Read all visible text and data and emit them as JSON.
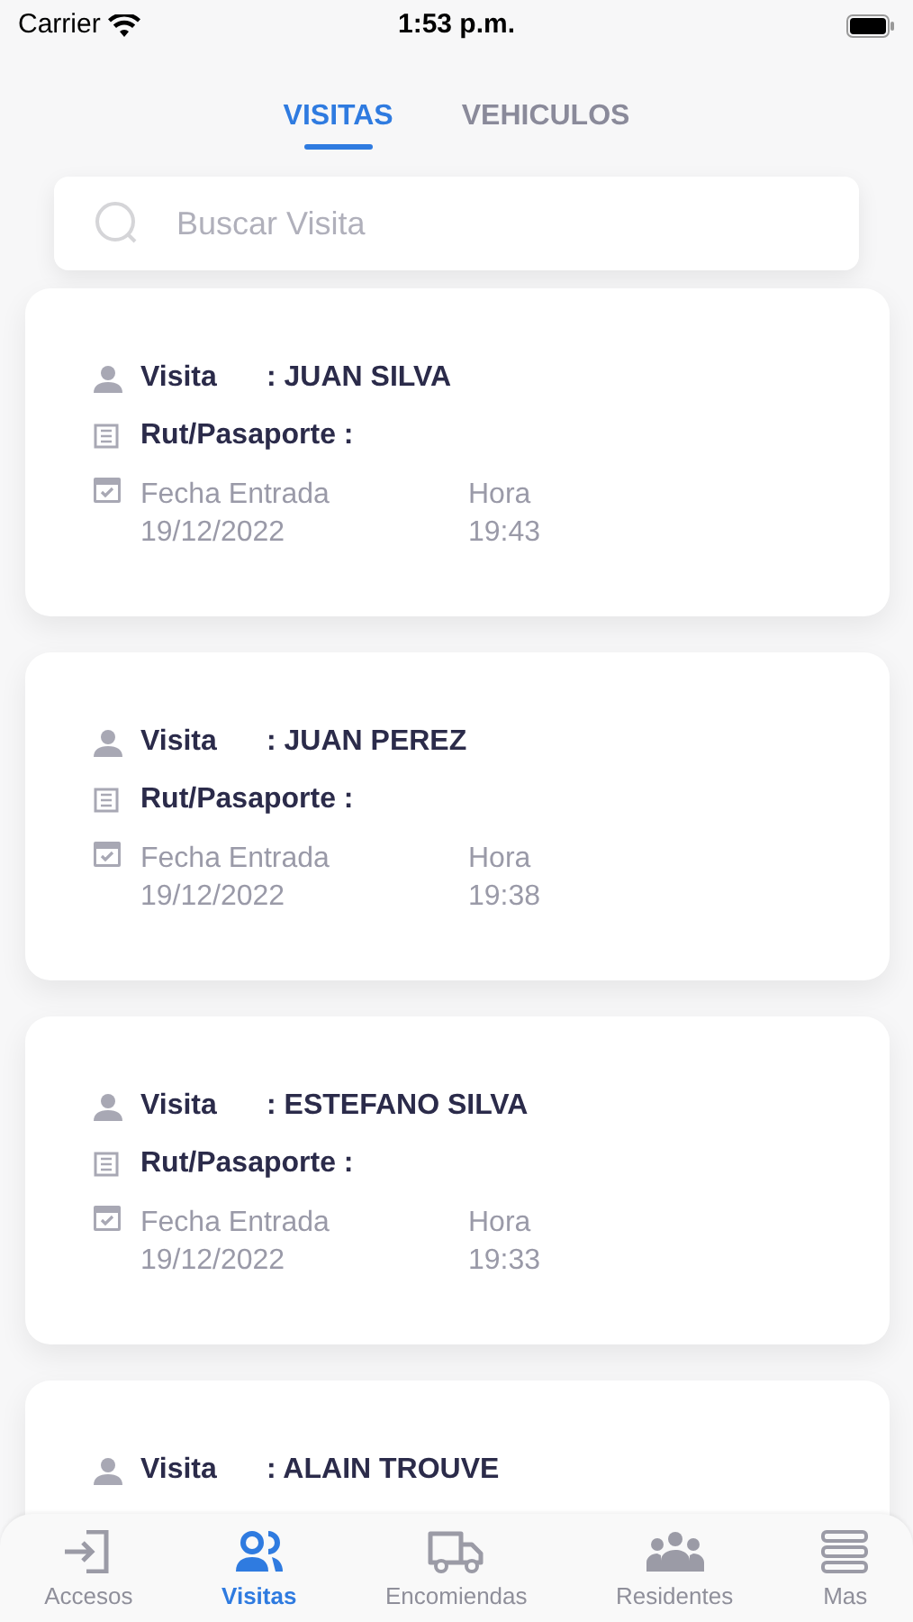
{
  "status_bar": {
    "carrier": "Carrier",
    "time": "1:53 p.m."
  },
  "tabs": [
    {
      "label": "VISITAS",
      "selected": true
    },
    {
      "label": "VEHICULOS",
      "selected": false
    }
  ],
  "search": {
    "placeholder": "Buscar Visita"
  },
  "visits": [
    {
      "visit_label": "Visita",
      "visitor": ": JUAN SILVA",
      "id_label": "Rut/Pasaporte :",
      "date_label": "Fecha Entrada",
      "date": "19/12/2022",
      "time_label": "Hora",
      "time": "19:43"
    },
    {
      "visit_label": "Visita",
      "visitor": ": JUAN PEREZ",
      "id_label": "Rut/Pasaporte :",
      "date_label": "Fecha Entrada",
      "date": "19/12/2022",
      "time_label": "Hora",
      "time": "19:38"
    },
    {
      "visit_label": "Visita",
      "visitor": ": ESTEFANO SILVA",
      "id_label": "Rut/Pasaporte :",
      "date_label": "Fecha Entrada",
      "date": "19/12/2022",
      "time_label": "Hora",
      "time": "19:33"
    },
    {
      "visit_label": "Visita",
      "visitor": ": ALAIN TROUVE"
    }
  ],
  "tab_bar": [
    {
      "label": "Accesos",
      "selected": false
    },
    {
      "label": "Visitas",
      "selected": true
    },
    {
      "label": "Encomiendas",
      "selected": false
    },
    {
      "label": "Residentes",
      "selected": false
    },
    {
      "label": "Mas",
      "selected": false
    }
  ]
}
